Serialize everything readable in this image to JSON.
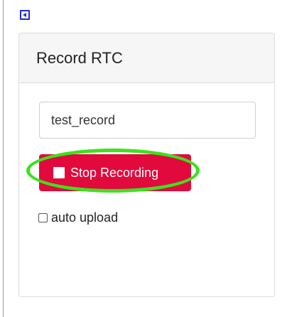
{
  "panel": {
    "collapse_icon": "collapse-left-icon"
  },
  "record_rtc": {
    "title": "Record RTC",
    "filename_input": {
      "value": "test_record",
      "placeholder": ""
    },
    "stop_button": {
      "label": "Stop Recording",
      "icon": "stop-square-icon",
      "color": "#e2093d"
    },
    "auto_upload": {
      "label": "auto upload",
      "checked": false
    },
    "highlight_color": "#3ee01f"
  }
}
